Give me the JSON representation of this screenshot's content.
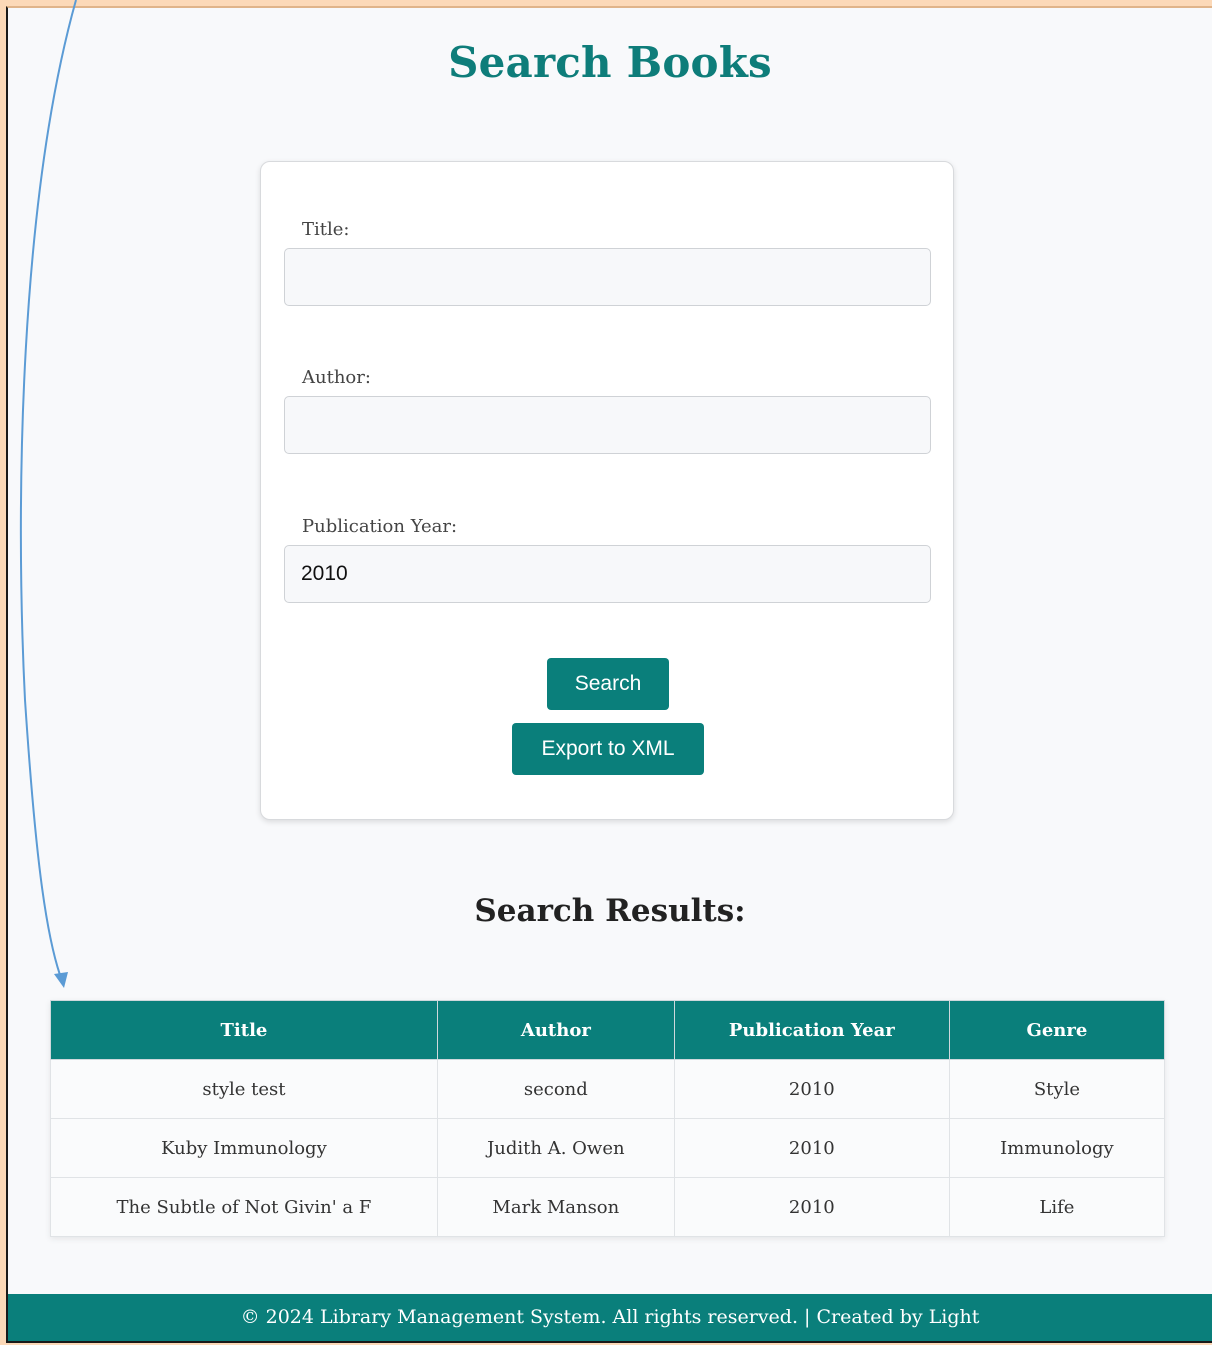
{
  "page": {
    "title": "Search Books"
  },
  "form": {
    "title_label": "Title:",
    "title_value": "",
    "author_label": "Author:",
    "author_value": "",
    "year_label": "Publication Year:",
    "year_value": "2010",
    "search_button": "Search",
    "export_button": "Export to XML"
  },
  "results": {
    "heading": "Search Results:",
    "columns": [
      "Title",
      "Author",
      "Publication Year",
      "Genre"
    ],
    "rows": [
      [
        "style test",
        "second",
        "2010",
        "Style"
      ],
      [
        "Kuby Immunology",
        "Judith A. Owen",
        "2010",
        "Immunology"
      ],
      [
        "The Subtle of Not Givin' a F",
        "Mark Manson",
        "2010",
        "Life"
      ]
    ]
  },
  "footer": {
    "text": "© 2024 Library Management System. All rights reserved. | Created by Light"
  },
  "colors": {
    "accent": "#0a7f7b",
    "annotation_arrow": "#5b9bd5",
    "outer_background": "#fcd9b8"
  }
}
